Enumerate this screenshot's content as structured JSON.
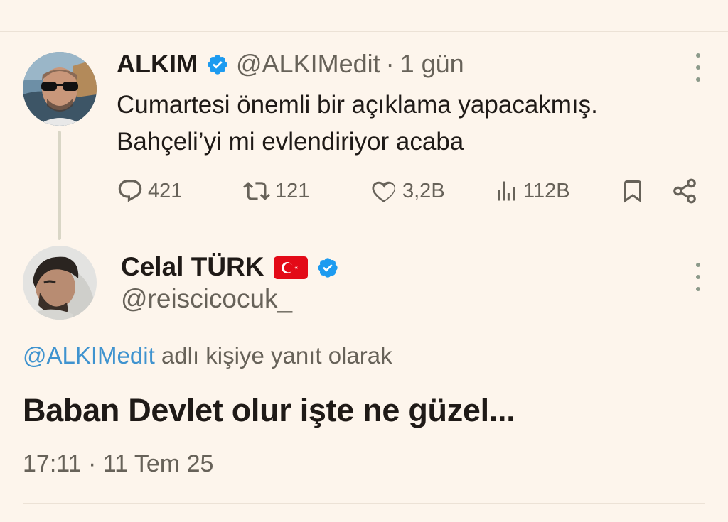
{
  "parent_tweet": {
    "name": "ALKIM",
    "handle": "@ALKIMedit",
    "separator": "·",
    "time": "1 gün",
    "text_line1": "Cumartesi önemli bir açıklama yapacakmış.",
    "text_line2": "Bahçeli’yi mi evlendiriyor acaba",
    "stats": {
      "replies": "421",
      "retweets": "121",
      "likes": "3,2B",
      "views": "112B"
    }
  },
  "reply_tweet": {
    "name": "Celal TÜRK",
    "handle": "@reiscicocuk_",
    "reply_to_mention": "@ALKIMedit",
    "reply_to_suffix": " adlı kişiye yanıt olarak",
    "text": "Baban Devlet olur işte ne güzel...",
    "timestamp": "17:11 · 11 Tem 25"
  },
  "colors": {
    "background": "#fdf5ec",
    "text": "#1f1a17",
    "secondary_text": "#676259",
    "accent": "#3f93cf",
    "verified_badge": "#1d9bf0",
    "flag_red": "#e30a17"
  },
  "icons": [
    "verified-badge-icon",
    "reply-icon",
    "retweet-icon",
    "like-icon",
    "views-icon",
    "bookmark-icon",
    "share-icon",
    "more-icon",
    "turkey-flag-icon"
  ]
}
